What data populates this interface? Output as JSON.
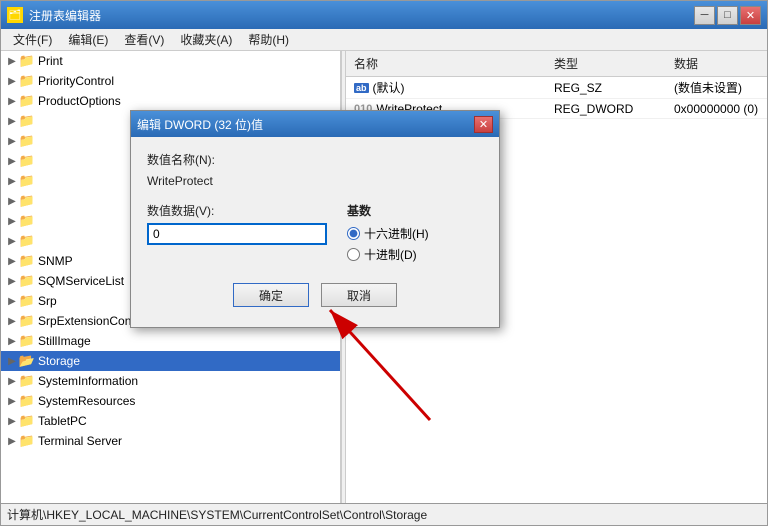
{
  "window": {
    "title": "注册表编辑器",
    "title_icon": "🗂"
  },
  "menu": {
    "items": [
      "文件(F)",
      "编辑(E)",
      "查看(V)",
      "收藏夹(A)",
      "帮助(H)"
    ]
  },
  "tree": {
    "items": [
      {
        "label": "Print",
        "indent": 0,
        "has_expander": true,
        "expanded": false
      },
      {
        "label": "PriorityControl",
        "indent": 0,
        "has_expander": true,
        "expanded": false
      },
      {
        "label": "ProductOptions",
        "indent": 0,
        "has_expander": true,
        "expanded": false
      },
      {
        "label": "",
        "indent": 0,
        "has_expander": true,
        "expanded": false
      },
      {
        "label": "",
        "indent": 0,
        "has_expander": true,
        "expanded": false
      },
      {
        "label": "",
        "indent": 0,
        "has_expander": true,
        "expanded": false
      },
      {
        "label": "",
        "indent": 0,
        "has_expander": true,
        "expanded": false
      },
      {
        "label": "",
        "indent": 0,
        "has_expander": true,
        "expanded": false
      },
      {
        "label": "",
        "indent": 0,
        "has_expander": true,
        "expanded": false
      },
      {
        "label": "SNMP",
        "indent": 0,
        "has_expander": true,
        "expanded": false
      },
      {
        "label": "SQMServiceList",
        "indent": 0,
        "has_expander": true,
        "expanded": false
      },
      {
        "label": "Srp",
        "indent": 0,
        "has_expander": true,
        "expanded": false
      },
      {
        "label": "SrpExtensionConfig",
        "indent": 0,
        "has_expander": true,
        "expanded": false
      },
      {
        "label": "StillImage",
        "indent": 0,
        "has_expander": true,
        "expanded": false
      },
      {
        "label": "Storage",
        "indent": 0,
        "has_expander": true,
        "expanded": false,
        "selected": true
      },
      {
        "label": "SystemInformation",
        "indent": 0,
        "has_expander": true,
        "expanded": false
      },
      {
        "label": "SystemResources",
        "indent": 0,
        "has_expander": true,
        "expanded": false
      },
      {
        "label": "TabletPC",
        "indent": 0,
        "has_expander": true,
        "expanded": false
      },
      {
        "label": "Terminal Server",
        "indent": 0,
        "has_expander": true,
        "expanded": false
      }
    ]
  },
  "right_pane": {
    "headers": [
      "名称",
      "类型",
      "数据"
    ],
    "rows": [
      {
        "name": "(默认)",
        "type": "REG_SZ",
        "data": "(数值未设置)",
        "icon": "ab"
      },
      {
        "name": "WriteProtect",
        "type": "REG_DWORD",
        "data": "0x00000000 (0)",
        "icon": "010"
      }
    ]
  },
  "dialog": {
    "title": "编辑 DWORD (32 位)值",
    "name_label": "数值名称(N):",
    "name_value": "WriteProtect",
    "data_label": "数值数据(V):",
    "data_value": "0",
    "base_label": "基数",
    "radio_hex": "十六进制(H)",
    "radio_dec": "十进制(D)",
    "btn_ok": "确定",
    "btn_cancel": "取消"
  },
  "status_bar": {
    "path": "计算机\\HKEY_LOCAL_MACHINE\\SYSTEM\\CurrentControlSet\\Control\\Storage"
  },
  "controls": {
    "minimize": "─",
    "restore": "□",
    "close": "✕"
  }
}
